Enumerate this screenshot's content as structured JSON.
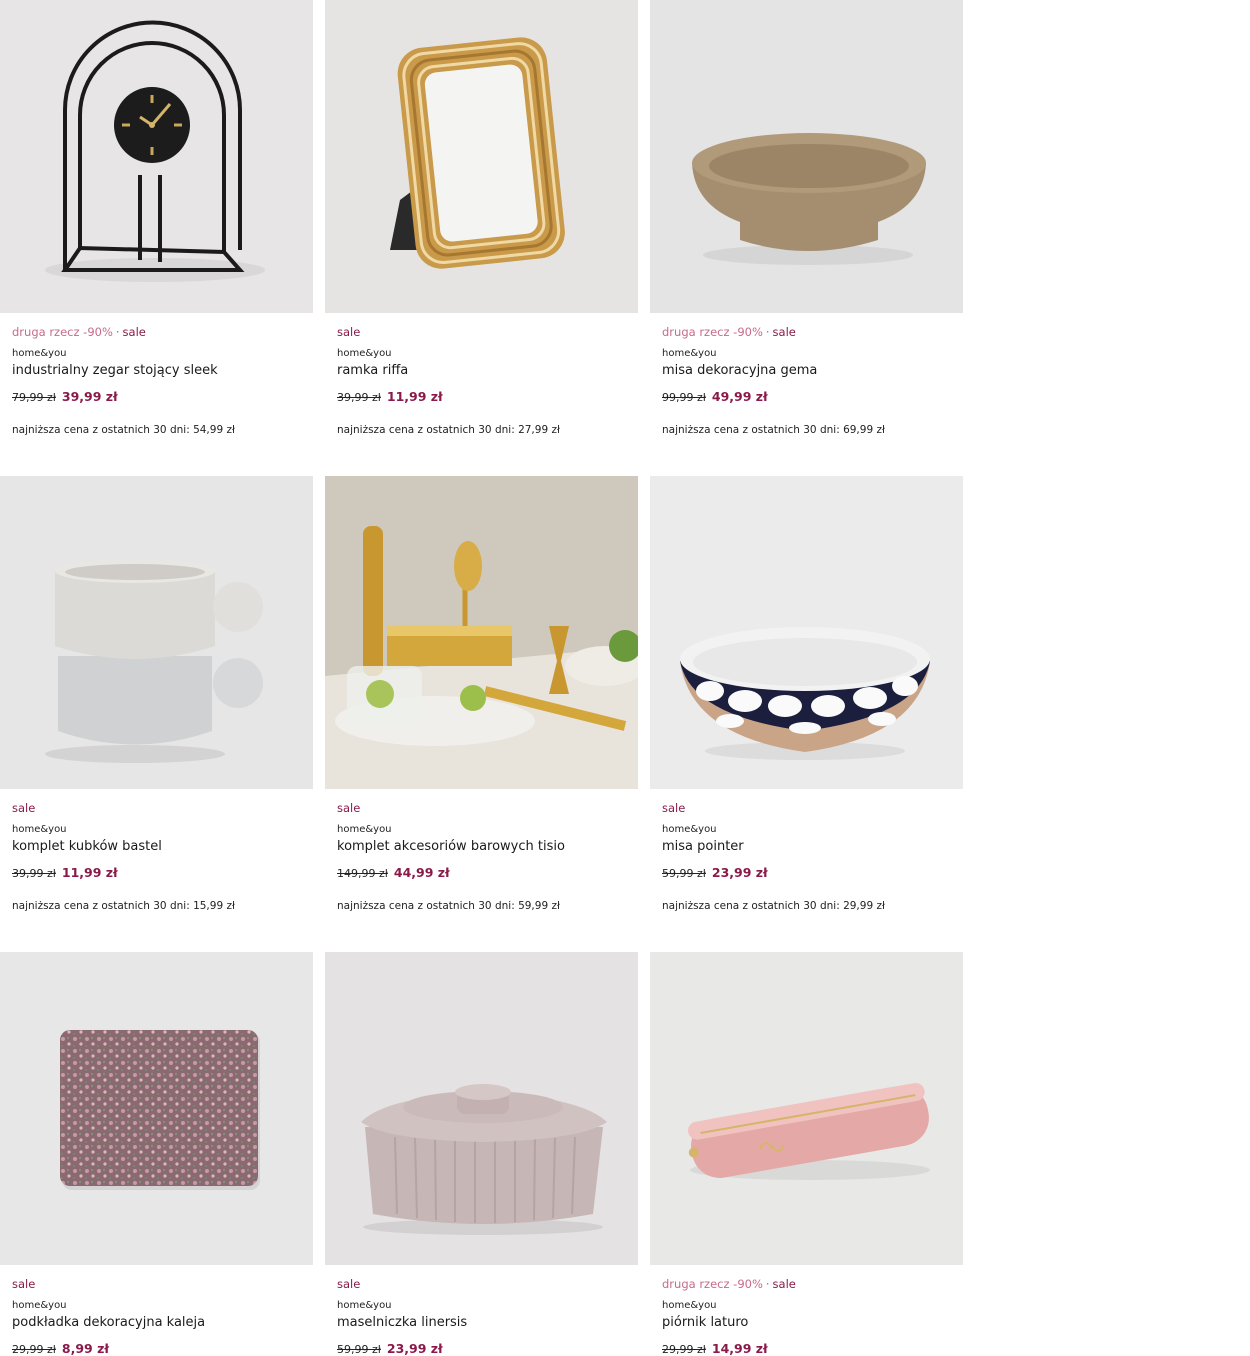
{
  "products": [
    {
      "promo": "druga rzecz -90%",
      "sale": "sale",
      "brand": "home&you",
      "name": "industrialny zegar stojący sleek",
      "old_price": "79,99 zł",
      "new_price": "39,99 zł",
      "lowest": "najniższa cena z ostatnich 30 dni: 54,99 zł",
      "image": "clock"
    },
    {
      "promo": "",
      "sale": "sale",
      "brand": "home&you",
      "name": "ramka riffa",
      "old_price": "39,99 zł",
      "new_price": "11,99 zł",
      "lowest": "najniższa cena z ostatnich 30 dni: 27,99 zł",
      "image": "frame"
    },
    {
      "promo": "druga rzecz -90%",
      "sale": "sale",
      "brand": "home&you",
      "name": "misa dekoracyjna gema",
      "old_price": "99,99 zł",
      "new_price": "49,99 zł",
      "lowest": "najniższa cena z ostatnich 30 dni: 69,99 zł",
      "image": "bowl-tan"
    },
    {
      "promo": "",
      "sale": "sale",
      "brand": "home&you",
      "name": "komplet kubków bastel",
      "old_price": "39,99 zł",
      "new_price": "11,99 zł",
      "lowest": "najniższa cena z ostatnich 30 dni: 15,99 zł",
      "image": "mugs"
    },
    {
      "promo": "",
      "sale": "sale",
      "brand": "home&you",
      "name": "komplet akcesoriów barowych tisio",
      "old_price": "149,99 zł",
      "new_price": "44,99 zł",
      "lowest": "najniższa cena z ostatnich 30 dni: 59,99 zł",
      "image": "bar-set"
    },
    {
      "promo": "",
      "sale": "sale",
      "brand": "home&you",
      "name": "misa pointer",
      "old_price": "59,99 zł",
      "new_price": "23,99 zł",
      "lowest": "najniższa cena z ostatnich 30 dni: 29,99 zł",
      "image": "bowl-dots"
    },
    {
      "promo": "",
      "sale": "sale",
      "brand": "home&you",
      "name": "podkładka dekoracyjna kaleja",
      "old_price": "29,99 zł",
      "new_price": "8,99 zł",
      "lowest": "",
      "image": "placemat"
    },
    {
      "promo": "",
      "sale": "sale",
      "brand": "home&you",
      "name": "maselniczka linersis",
      "old_price": "59,99 zł",
      "new_price": "23,99 zł",
      "lowest": "",
      "image": "butter-dish"
    },
    {
      "promo": "druga rzecz -90%",
      "sale": "sale",
      "brand": "home&you",
      "name": "piórnik laturo",
      "old_price": "29,99 zł",
      "new_price": "14,99 zł",
      "lowest": "",
      "image": "pencil-case"
    }
  ],
  "separator": "·"
}
